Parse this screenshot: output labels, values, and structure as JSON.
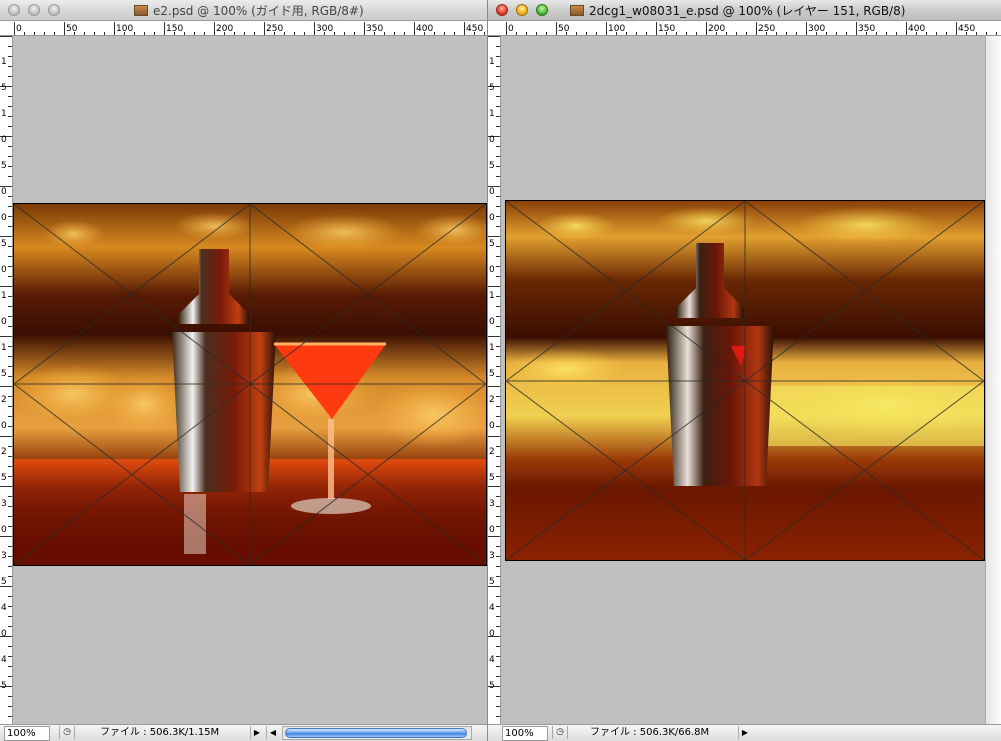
{
  "left_window": {
    "title": "e2.psd @ 100% (ガイド用, RGB/8#)",
    "ruler_marks": [
      "0",
      "50",
      "100",
      "150",
      "200",
      "250",
      "300",
      "350",
      "400",
      "450"
    ],
    "vruler_marks": [
      "1",
      "5",
      "1",
      "0",
      "5",
      "0",
      "0",
      "5",
      "0",
      "1",
      "0",
      "1",
      "5",
      "2",
      "0",
      "2",
      "5",
      "3",
      "0",
      "3",
      "5",
      "4",
      "0",
      "4",
      "5"
    ],
    "zoom": "100%",
    "file_info": "ファイル : 506.3K/1.15M"
  },
  "right_window": {
    "title": "2dcg1_w08031_e.psd @ 100% (レイヤー 151, RGB/8)",
    "ruler_marks": [
      "0",
      "50",
      "100",
      "150",
      "200",
      "250",
      "300",
      "350",
      "400",
      "450"
    ],
    "vruler_marks": [
      "1",
      "5",
      "1",
      "0",
      "5",
      "0",
      "0",
      "5",
      "0",
      "1",
      "0",
      "1",
      "5",
      "2",
      "0",
      "2",
      "5",
      "3",
      "0",
      "3",
      "5",
      "4",
      "0",
      "4",
      "5"
    ],
    "zoom": "100%",
    "file_info": "ファイル : 506.3K/66.8M"
  },
  "colors": {
    "workspace": "#c0c0c0",
    "scroll_thumb": "#3d82e0"
  },
  "icons": {
    "close": "close-button-icon",
    "minimize": "minimize-button-icon",
    "zoom": "zoom-button-icon",
    "document": "psd-document-icon"
  }
}
